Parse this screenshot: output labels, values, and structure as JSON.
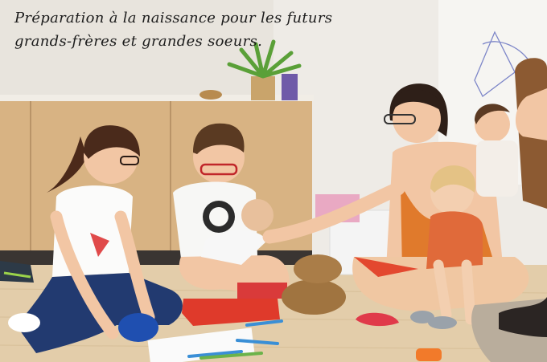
{
  "caption": {
    "line1": "Préparation à la naissance pour les futurs",
    "line2": "grands-frères et grandes soeurs."
  },
  "colors": {
    "wall": "#efece7",
    "floor": "#e4cfae",
    "cabinet": "#d9b585",
    "red_cushion": "#e0392b",
    "blue_cushion": "#1f4fb0"
  }
}
